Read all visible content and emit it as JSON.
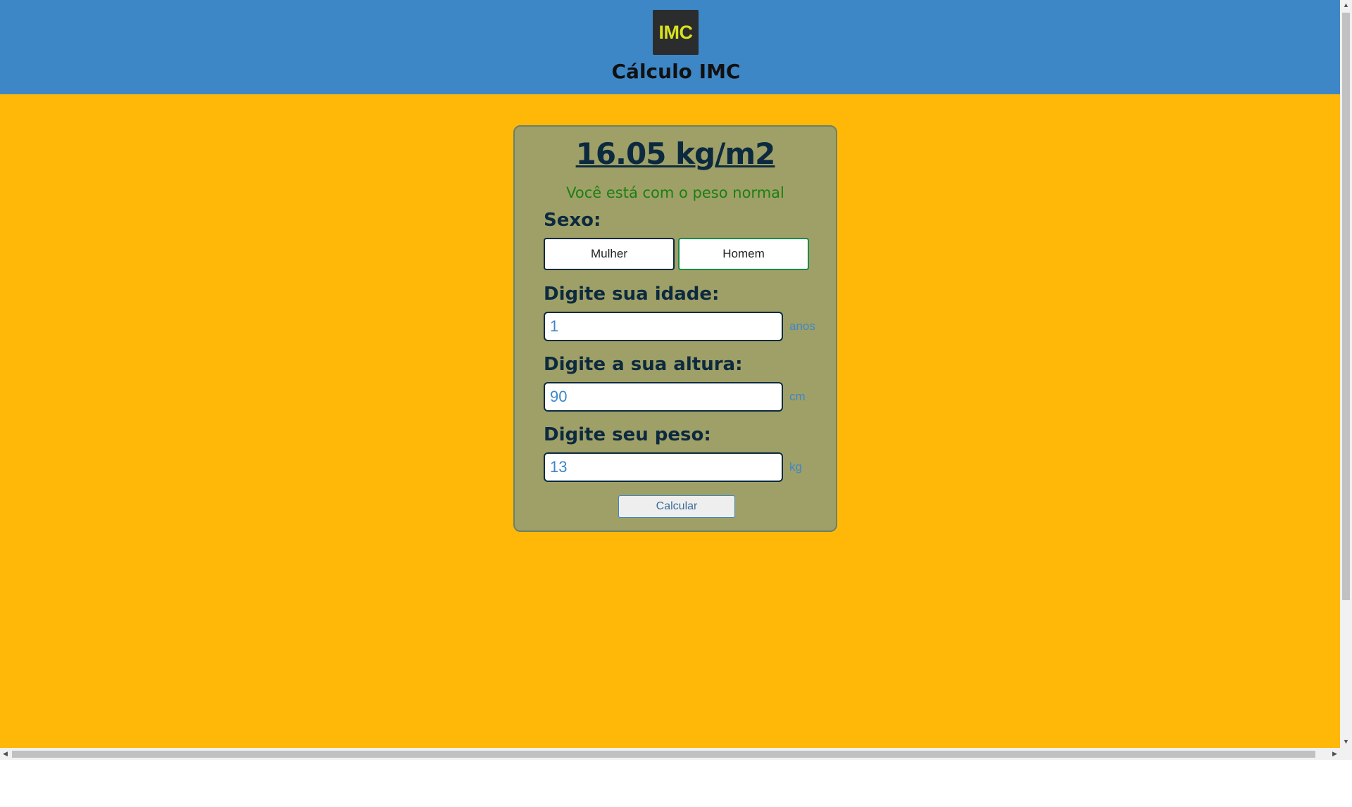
{
  "header": {
    "logo_text": "IMC",
    "title": "Cálculo IMC"
  },
  "card": {
    "result": "16.05 kg/m2",
    "status": "Você está com o peso normal",
    "sex_label": "Sexo:",
    "sex_options": [
      "Mulher",
      "Homem"
    ],
    "sex_selected": "Homem",
    "age_label": "Digite sua idade:",
    "age_value": "1",
    "age_unit": "anos",
    "height_label": "Digite a sua altura:",
    "height_value": "90",
    "height_unit": "cm",
    "weight_label": "Digite seu peso:",
    "weight_value": "13",
    "weight_unit": "kg",
    "calculate_label": "Calcular"
  },
  "colors": {
    "header_bg": "#3e87c7",
    "page_bg": "#ffb807",
    "card_bg": "#9fa067",
    "status_text": "#1b7f13",
    "logo_bg": "#2b2c2d",
    "logo_text": "#d9e21e"
  }
}
